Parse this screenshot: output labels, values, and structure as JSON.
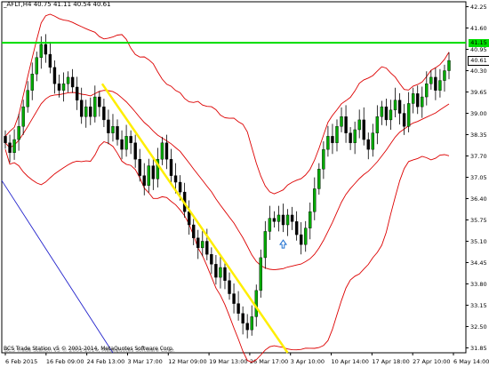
{
  "chart_data": {
    "type": "candlestick",
    "symbol": "_AFLT,H4",
    "ohlc_header": "40.75 41.11 40.54 40.61",
    "footer": "BCS Trade Station v5 © 2001-2014, MetaQuotes Software Corp.",
    "footer2": "BCS Trade Station v5 © 2001-2014, MetaQuotes Software Corp.",
    "y_ticks": [
      "42.25",
      "41.60",
      "40.95",
      "40.30",
      "39.65",
      "39.00",
      "38.35",
      "37.70",
      "37.05",
      "36.40",
      "35.75",
      "35.10",
      "34.45",
      "33.80",
      "33.15",
      "32.50",
      "31.85"
    ],
    "x_ticks": [
      "6 Feb 2015",
      "16 Feb 09:00",
      "24 Feb 13:00",
      "3 Mar 17:00",
      "12 Mar 09:00",
      "19 Mar 13:00",
      "26 Mar 17:00",
      "3 Apr 10:00",
      "10 Apr 14:00",
      "17 Apr 18:00",
      "27 Apr 10:00",
      "6 May 14:00"
    ],
    "ylim": [
      31.7,
      42.4
    ],
    "horizontal_line": {
      "value": 41.15,
      "label": "41.15",
      "color": "#00dd00"
    },
    "current_price": {
      "value": 40.61,
      "label": "40.61"
    },
    "colors": {
      "bull": "#00aa00",
      "bear": "#000000",
      "bands": "#dd0000",
      "trend_yellow": "#ffee00",
      "trend_blue": "#2222cc",
      "arrow": "#1e6fd0"
    },
    "closes": [
      38.1,
      37.8,
      38.2,
      38.6,
      39.2,
      39.7,
      40.2,
      40.7,
      41.1,
      40.8,
      40.4,
      39.9,
      39.7,
      39.9,
      40.1,
      39.8,
      39.4,
      38.9,
      39.2,
      38.9,
      39.5,
      39.2,
      38.8,
      38.4,
      38.6,
      38.2,
      37.9,
      38.3,
      38.1,
      37.6,
      37.1,
      36.8,
      37.4,
      37.0,
      37.6,
      38.1,
      37.6,
      37.1,
      36.9,
      36.6,
      36.0,
      35.6,
      35.2,
      34.9,
      35.1,
      34.7,
      34.4,
      34.0,
      34.3,
      33.9,
      33.5,
      33.2,
      32.9,
      32.6,
      32.4,
      32.8,
      33.6,
      34.6,
      35.4,
      35.8,
      35.7,
      35.9,
      35.6,
      35.9,
      35.7,
      35.3,
      35.0,
      35.5,
      36.0,
      36.7,
      37.3,
      37.9,
      38.3,
      38.1,
      38.6,
      38.9,
      38.4,
      38.1,
      38.5,
      38.8,
      38.2,
      37.9,
      38.4,
      38.9,
      39.2,
      38.8,
      39.1,
      39.4,
      39.0,
      38.6,
      39.3,
      39.6,
      39.2,
      39.5,
      39.9,
      40.1,
      39.7,
      40.0,
      40.3,
      40.61
    ],
    "bollinger": {
      "period": 20
    }
  }
}
